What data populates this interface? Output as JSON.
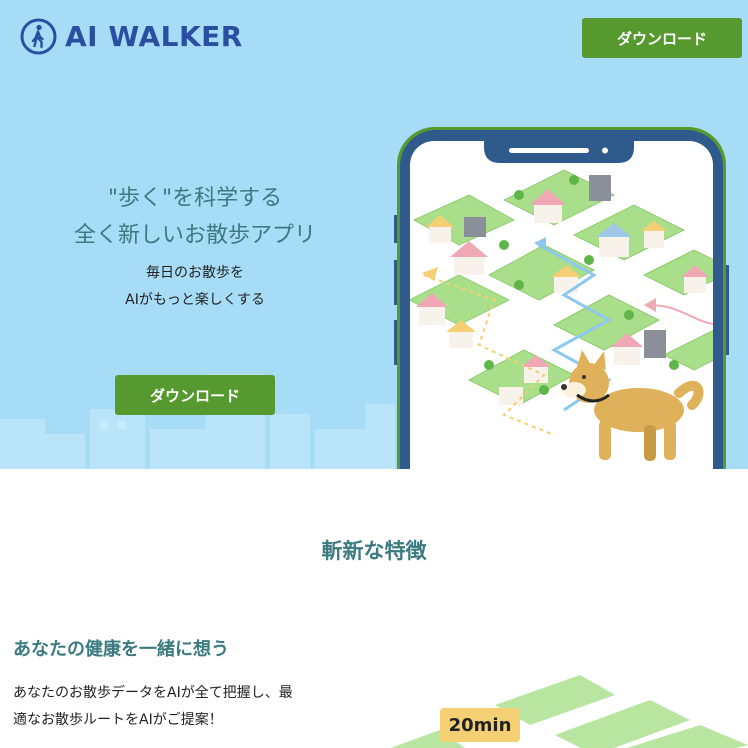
{
  "header": {
    "brand_name": "AI WALKER",
    "download_label": "ダウンロード"
  },
  "hero": {
    "headline_line1": "\"歩く\"を科学する",
    "headline_line2": "全く新しいお散歩アプリ",
    "sub_line1": "毎日のお散歩を",
    "sub_line2": "AIがもっと楽しくする",
    "download_label": "ダウンロード"
  },
  "features": {
    "title": "斬新な特徴",
    "item1": {
      "heading": "あなたの健康を一緒に想う",
      "body_line1": "あなたのお散歩データをAIが全て把握し、最",
      "body_line2": "適なお散歩ルートをAIがご提案！",
      "badge": "20min"
    }
  },
  "colors": {
    "hero_bg": "#a7dcf7",
    "brand_blue": "#2a4fa0",
    "button_green": "#55992f",
    "heading_teal": "#3b7a80",
    "phone_frame": "#2f5a8c",
    "phone_rim": "#55992f",
    "block_green": "#a9df8a",
    "badge_yellow": "#f4cf74"
  },
  "icons": {
    "brand": "walking-person-icon"
  }
}
